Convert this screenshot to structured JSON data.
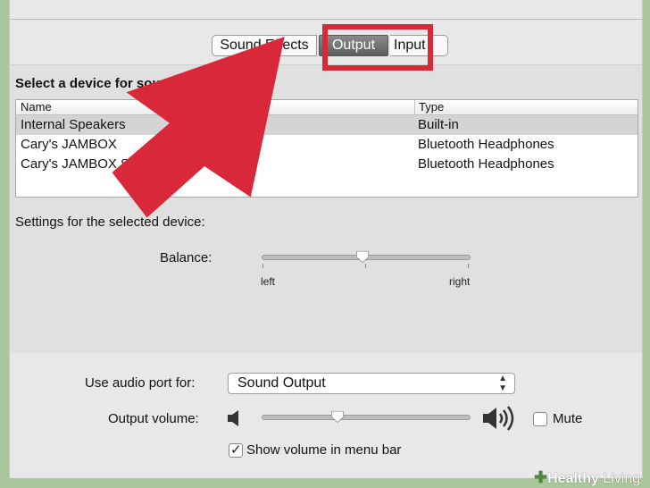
{
  "tabs": [
    {
      "label": "Sound Effects"
    },
    {
      "label": "Output"
    },
    {
      "label": "Input"
    }
  ],
  "output_panel": {
    "select_title": "Select a device for sound output:",
    "columns": {
      "name": "Name",
      "type": "Type"
    },
    "devices": [
      {
        "name": "Internal Speakers",
        "type": "Built-in",
        "selected": true
      },
      {
        "name": "Cary's JAMBOX",
        "type": "Bluetooth Headphones",
        "selected": false
      },
      {
        "name": "Cary's JAMBOX Stereo",
        "type": "Bluetooth Headphones",
        "selected": false
      }
    ],
    "settings_title": "Settings for the selected device:",
    "balance": {
      "label": "Balance:",
      "left_label": "left",
      "right_label": "right",
      "value": 0.5
    }
  },
  "bottom": {
    "audio_port_label": "Use audio port for:",
    "audio_port_value": "Sound Output",
    "volume_label": "Output volume:",
    "volume_value": 0.38,
    "mute_label": "Mute",
    "mute_checked": false,
    "menu_bar_label": "Show volume in menu bar",
    "menu_bar_checked": true
  },
  "icons": {
    "volume_low": "speaker-low-icon",
    "volume_high": "speaker-high-icon",
    "select_arrows": "up-down-arrows-icon"
  },
  "colors": {
    "highlight_red": "#d8283a",
    "background_green": "#a9c79a"
  },
  "watermark": {
    "brand_bold": "Healthy",
    "brand_light": "Living"
  }
}
